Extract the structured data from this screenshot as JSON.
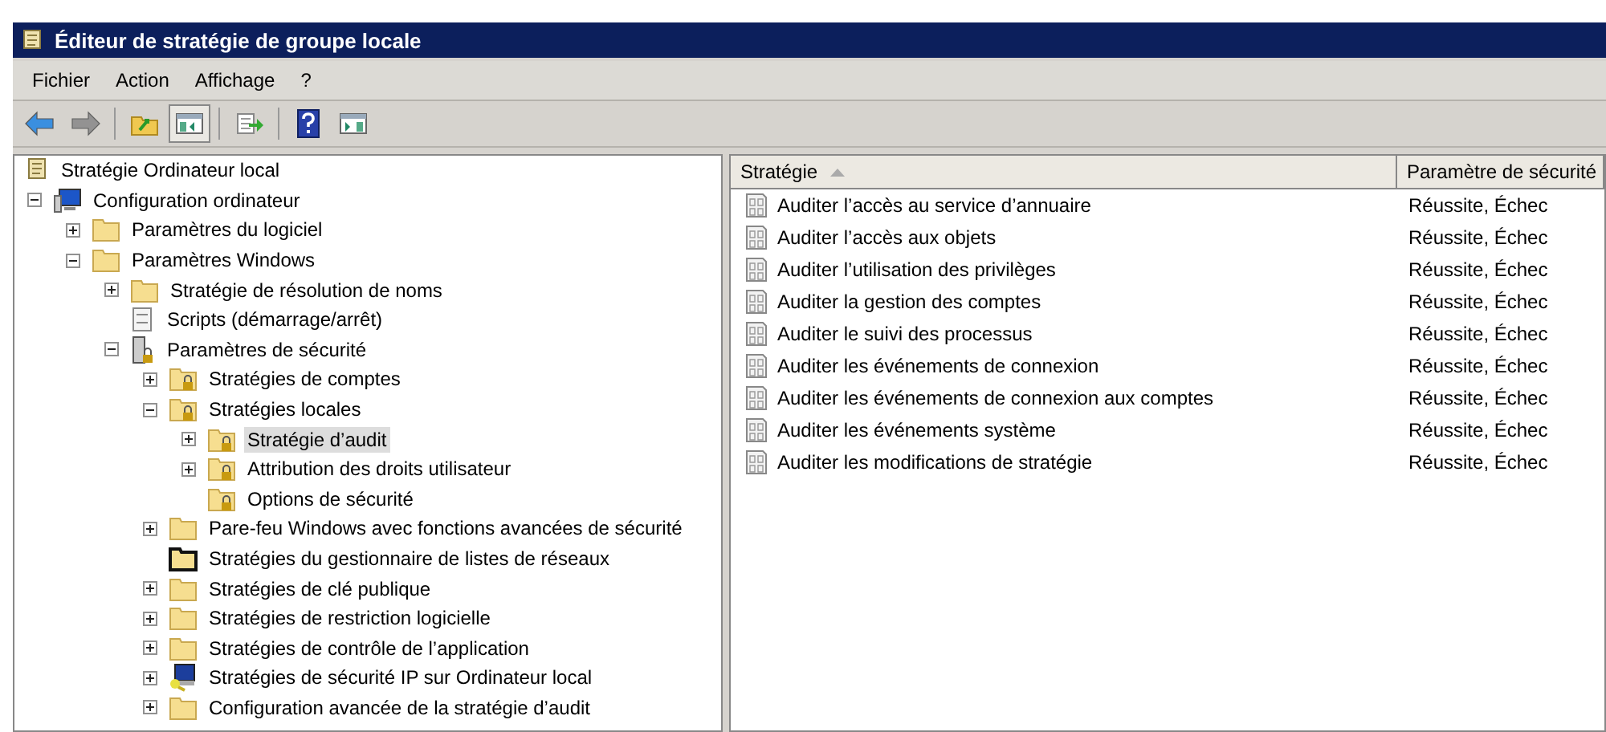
{
  "window": {
    "title": "Éditeur de stratégie de groupe locale"
  },
  "menu": [
    "Fichier",
    "Action",
    "Affichage",
    "?"
  ],
  "toolbar": [
    {
      "kind": "back",
      "disabled": false
    },
    {
      "kind": "forward",
      "disabled": true
    },
    {
      "kind": "sep"
    },
    {
      "kind": "up",
      "disabled": false
    },
    {
      "kind": "tree",
      "disabled": false,
      "pressed": true
    },
    {
      "kind": "sep"
    },
    {
      "kind": "export",
      "disabled": false
    },
    {
      "kind": "sep"
    },
    {
      "kind": "help",
      "disabled": false
    },
    {
      "kind": "pane",
      "disabled": false
    }
  ],
  "tree": [
    {
      "label": "Stratégie Ordinateur local",
      "kind": "scroll",
      "selected": false,
      "children": [
        {
          "label": "Configuration ordinateur",
          "kind": "computer",
          "expanded": true,
          "selected": false,
          "children": [
            {
              "label": "Paramètres du logiciel",
              "kind": "folder",
              "expanded": false,
              "selected": false
            },
            {
              "label": "Paramètres Windows",
              "kind": "folder",
              "expanded": true,
              "selected": false,
              "children": [
                {
                  "label": "Stratégie de résolution de noms",
                  "kind": "folder",
                  "expanded": false,
                  "selected": false
                },
                {
                  "label": "Scripts (démarrage/arrêt)",
                  "kind": "script",
                  "selected": false
                },
                {
                  "label": "Paramètres de sécurité",
                  "kind": "server",
                  "expanded": true,
                  "selected": false,
                  "children": [
                    {
                      "label": "Stratégies de comptes",
                      "kind": "lock-folder",
                      "expanded": false,
                      "selected": false
                    },
                    {
                      "label": "Stratégies locales",
                      "kind": "lock-folder",
                      "expanded": true,
                      "selected": false,
                      "children": [
                        {
                          "label": "Stratégie d’audit",
                          "kind": "lock-folder",
                          "expanded": false,
                          "selected": true
                        },
                        {
                          "label": "Attribution des droits utilisateur",
                          "kind": "lock-folder",
                          "expanded": false,
                          "selected": false
                        },
                        {
                          "label": "Options de sécurité",
                          "kind": "lock-folder",
                          "selected": false
                        }
                      ]
                    },
                    {
                      "label": "Pare-feu Windows avec fonctions avancées de sécurité",
                      "kind": "folder",
                      "expanded": false,
                      "selected": false
                    },
                    {
                      "label": "Stratégies du gestionnaire de listes de réseaux",
                      "kind": "dark-folder",
                      "selected": false
                    },
                    {
                      "label": "Stratégies de clé publique",
                      "kind": "folder",
                      "expanded": false,
                      "selected": false
                    },
                    {
                      "label": "Stratégies de restriction logicielle",
                      "kind": "folder",
                      "expanded": false,
                      "selected": false
                    },
                    {
                      "label": "Stratégies de contrôle de l’application",
                      "kind": "folder",
                      "expanded": false,
                      "selected": false
                    },
                    {
                      "label": "Stratégies de sécurité IP sur Ordinateur local",
                      "kind": "ip",
                      "expanded": false,
                      "selected": false
                    },
                    {
                      "label": "Configuration avancée de la stratégie d’audit",
                      "kind": "folder",
                      "expanded": false,
                      "selected": false
                    }
                  ]
                }
              ]
            }
          ]
        }
      ]
    }
  ],
  "table": {
    "columns": [
      {
        "label": "Stratégie",
        "sorted": true
      },
      {
        "label": "Paramètre de sécurité"
      }
    ],
    "rows": [
      {
        "policy": "Auditer l’accès au service d’annuaire",
        "setting": "Réussite, Échec"
      },
      {
        "policy": "Auditer l’accès aux objets",
        "setting": "Réussite, Échec"
      },
      {
        "policy": "Auditer l’utilisation des privilèges",
        "setting": "Réussite, Échec"
      },
      {
        "policy": "Auditer la gestion des comptes",
        "setting": "Réussite, Échec"
      },
      {
        "policy": "Auditer le suivi des processus",
        "setting": "Réussite, Échec"
      },
      {
        "policy": "Auditer les événements de connexion",
        "setting": "Réussite, Échec"
      },
      {
        "policy": "Auditer les événements de connexion aux comptes",
        "setting": "Réussite, Échec"
      },
      {
        "policy": "Auditer les événements système",
        "setting": "Réussite, Échec"
      },
      {
        "policy": "Auditer les modifications de stratégie",
        "setting": "Réussite, Échec"
      }
    ]
  }
}
